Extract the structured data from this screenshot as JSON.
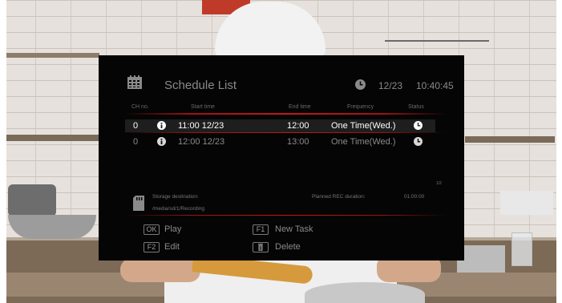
{
  "title_bar": {
    "title": "Schedule List",
    "date": "12/23",
    "time": "10:40:45",
    "calendar_icon": "calendar-icon",
    "clock_icon": "clock-icon"
  },
  "table": {
    "headers": {
      "ch_no": "CH no.",
      "start_time": "Start time",
      "end_time": "End time",
      "frequency": "Frequency",
      "status": "Status"
    },
    "rows": [
      {
        "ch": "0",
        "start": "11:00  12/23",
        "end": "12:00",
        "frequency": "One Time(Wed.)",
        "status_icon": "clock-icon",
        "selected": true
      },
      {
        "ch": "0",
        "start": "12:00  12/23",
        "end": "13:00",
        "frequency": "One Time(Wed.)",
        "status_icon": "clock-icon",
        "selected": false
      }
    ]
  },
  "page_indicator": "1/2",
  "storage": {
    "label": "Storage destination:",
    "path": "/media/sd/1/Recording",
    "icon": "sd-card-icon"
  },
  "planned": {
    "label": "Planned REC duration:",
    "value": "01:00:00"
  },
  "actions": {
    "play": {
      "key": "OK",
      "label": "Play"
    },
    "new_task": {
      "key": "F1",
      "label": "New Task"
    },
    "edit": {
      "key": "F2",
      "label": "Edit"
    },
    "delete": {
      "key_icon": "trash-icon",
      "label": "Delete"
    }
  },
  "colors": {
    "dialog_bg": "#050505",
    "accent_line": "#c21818",
    "selected_text": "#ffffff",
    "normal_text": "#8a8a8a"
  }
}
